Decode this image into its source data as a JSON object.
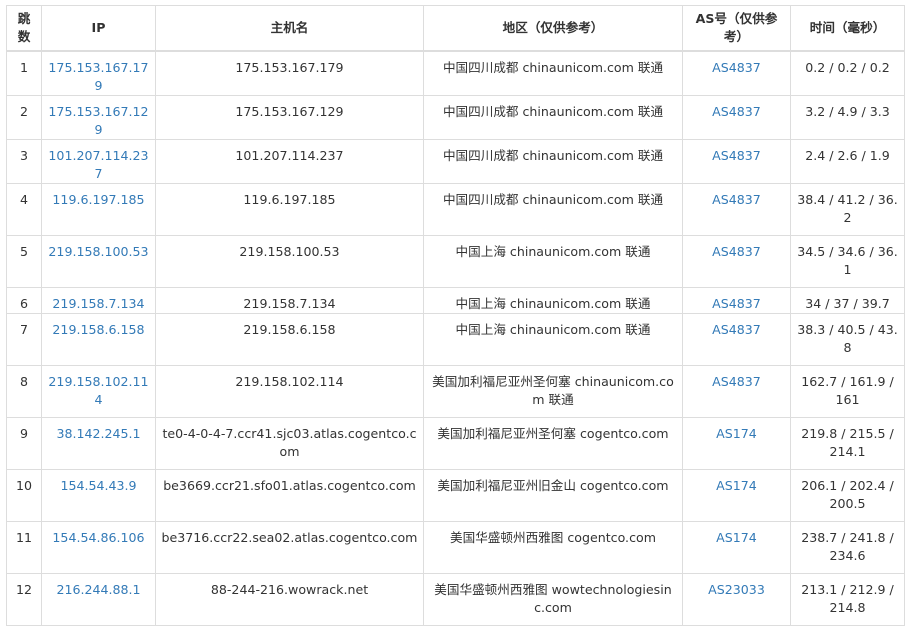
{
  "headers": {
    "hop": "跳数",
    "ip": "IP",
    "host": "主机名",
    "loc": "地区（仅供参考）",
    "as": "AS号（仅供参考）",
    "time": "时间（毫秒）"
  },
  "rows": [
    {
      "hop": "1",
      "ip": "175.153.167.179",
      "host": "175.153.167.179",
      "loc": "中国四川成都 chinaunicom.com 联通",
      "as": "AS4837",
      "time": "0.2 / 0.2 / 0.2"
    },
    {
      "hop": "2",
      "ip": "175.153.167.129",
      "host": "175.153.167.129",
      "loc": "中国四川成都 chinaunicom.com 联通",
      "as": "AS4837",
      "time": "3.2 / 4.9 / 3.3"
    },
    {
      "hop": "3",
      "ip": "101.207.114.237",
      "host": "101.207.114.237",
      "loc": "中国四川成都 chinaunicom.com 联通",
      "as": "AS4837",
      "time": "2.4 / 2.6 / 1.9"
    },
    {
      "hop": "4",
      "ip": "119.6.197.185",
      "host": "119.6.197.185",
      "loc": "中国四川成都 chinaunicom.com 联通",
      "as": "AS4837",
      "time": "38.4 / 41.2 / 36.2"
    },
    {
      "hop": "5",
      "ip": "219.158.100.53",
      "host": "219.158.100.53",
      "loc": "中国上海 chinaunicom.com 联通",
      "as": "AS4837",
      "time": "34.5 / 34.6 / 36.1"
    },
    {
      "hop": "6",
      "ip": "219.158.7.134",
      "host": "219.158.7.134",
      "loc": "中国上海 chinaunicom.com 联通",
      "as": "AS4837",
      "time": "34 / 37 / 39.7"
    },
    {
      "hop": "7",
      "ip": "219.158.6.158",
      "host": "219.158.6.158",
      "loc": "中国上海 chinaunicom.com 联通",
      "as": "AS4837",
      "time": "38.3 / 40.5 / 43.8"
    },
    {
      "hop": "8",
      "ip": "219.158.102.114",
      "host": "219.158.102.114",
      "loc": "美国加利福尼亚州圣何塞 chinaunicom.com 联通",
      "as": "AS4837",
      "time": "162.7 / 161.9 / 161"
    },
    {
      "hop": "9",
      "ip": "38.142.245.1",
      "host": "te0-4-0-4-7.ccr41.sjc03.atlas.cogentco.com",
      "loc": "美国加利福尼亚州圣何塞 cogentco.com",
      "as": "AS174",
      "time": "219.8 / 215.5 / 214.1"
    },
    {
      "hop": "10",
      "ip": "154.54.43.9",
      "host": "be3669.ccr21.sfo01.atlas.cogentco.com",
      "loc": "美国加利福尼亚州旧金山 cogentco.com",
      "as": "AS174",
      "time": "206.1 / 202.4 / 200.5"
    },
    {
      "hop": "11",
      "ip": "154.54.86.106",
      "host": "be3716.ccr22.sea02.atlas.cogentco.com",
      "loc": "美国华盛顿州西雅图 cogentco.com",
      "as": "AS174",
      "time": "238.7 / 241.8 / 234.6"
    },
    {
      "hop": "12",
      "ip": "216.244.88.1",
      "host": "88-244-216.wowrack.net",
      "loc": "美国华盛顿州西雅图 wowtechnologiesinc.com",
      "as": "AS23033",
      "time": "213.1 / 212.9 / 214.8"
    }
  ]
}
